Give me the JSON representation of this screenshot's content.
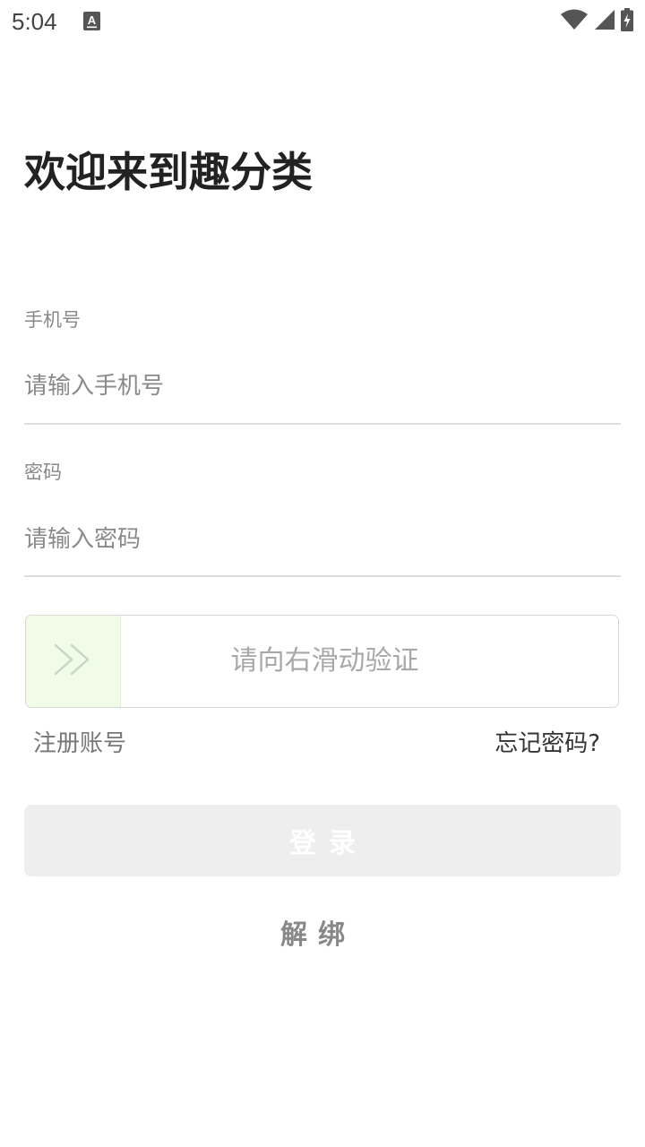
{
  "status_bar": {
    "time": "5:04",
    "notification_icon": "a-text-icon",
    "right_icons": [
      "wifi-icon",
      "cell-signal-icon",
      "battery-charging-icon"
    ]
  },
  "title": "欢迎来到趣分类",
  "phone": {
    "label": "手机号",
    "placeholder": "请输入手机号",
    "value": ""
  },
  "password": {
    "label": "密码",
    "placeholder": "请输入密码",
    "value": ""
  },
  "slider": {
    "text": "请向右滑动验证",
    "handle_icon": "double-chevron-right-icon",
    "progress": 0
  },
  "links": {
    "register": "注册账号",
    "forgot": "忘记密码?"
  },
  "login_button": "登录",
  "unbind": "解绑",
  "colors": {
    "slider_handle": "#f0fbe8",
    "button_disabled": "#eeeeee",
    "label_gray": "#888888"
  }
}
